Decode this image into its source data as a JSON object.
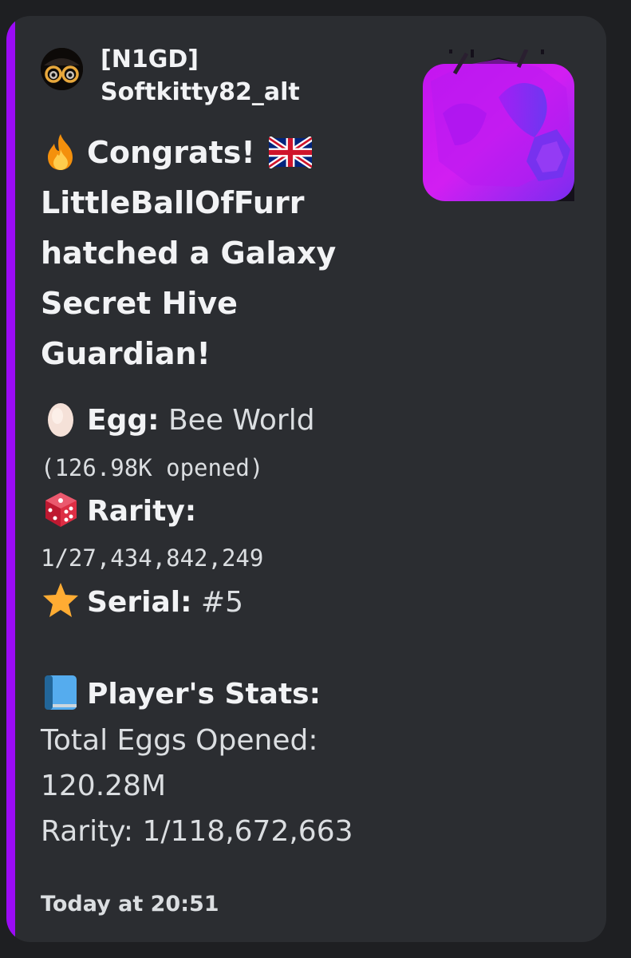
{
  "message": {
    "accent_color": "#9b0bf5",
    "author": {
      "tag": "[N1GD]",
      "name": "Softkitty82_alt"
    },
    "title_lines": [
      "Congrats!",
      "LittleBallOfFurr",
      "hatched a Galaxy",
      "Secret Hive",
      "Guardian!"
    ],
    "title_icons": [
      "fire-emoji",
      "uk-flag-emoji"
    ],
    "fields": {
      "egg_label": "Egg:",
      "egg_value": "Bee World",
      "egg_opened": "(126.98K opened)",
      "rarity_label": "Rarity:",
      "rarity_value": "1/27,434,842,249",
      "serial_label": "Serial:",
      "serial_value": "#5",
      "icons": [
        "egg-emoji",
        "dice-emoji",
        "star-emoji",
        "blue-book-emoji"
      ]
    },
    "player_stats": {
      "label": "Player's Stats:",
      "total_eggs_label": "Total Eggs Opened:",
      "total_eggs_value": "120.28M",
      "rarity": "Rarity: 1/118,672,663"
    },
    "timestamp": "Today at 20:51"
  }
}
